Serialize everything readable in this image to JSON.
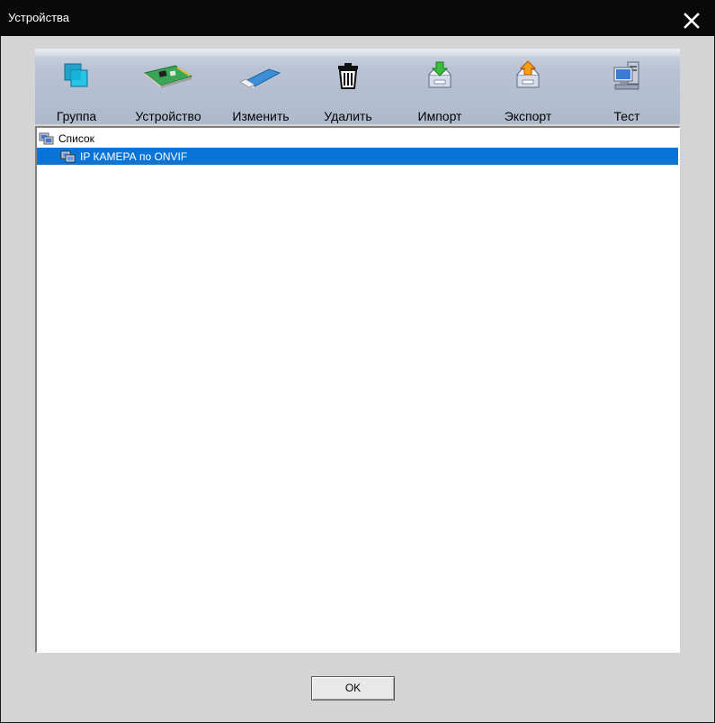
{
  "window": {
    "title": "Устройства"
  },
  "toolbar": {
    "buttons": [
      {
        "label": "Группа",
        "icon": "group-icon"
      },
      {
        "label": "Устройство",
        "icon": "device-card-icon"
      },
      {
        "label": "Изменить",
        "icon": "edit-icon"
      },
      {
        "label": "Удалить",
        "icon": "trash-icon"
      },
      {
        "label": "Импорт",
        "icon": "import-icon"
      },
      {
        "label": "Экспорт",
        "icon": "export-icon"
      },
      {
        "label": "Тест",
        "icon": "test-computer-icon"
      }
    ]
  },
  "tree": {
    "root_label": "Список",
    "children": [
      {
        "label": "IP КАМЕРА по ONVIF",
        "selected": true
      }
    ]
  },
  "footer": {
    "ok_label": "OK"
  },
  "colors": {
    "selection": "#0a74d6",
    "titlebar": "#0a0a0a",
    "client": "#d4d4d4"
  }
}
